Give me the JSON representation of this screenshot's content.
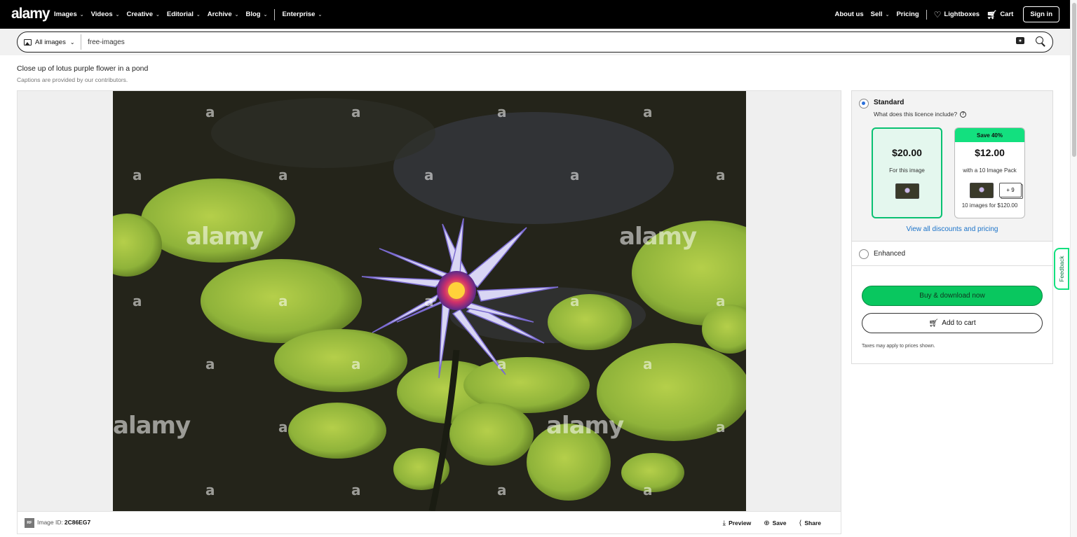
{
  "nav": {
    "logo": "alamy",
    "links": [
      {
        "label": "Images"
      },
      {
        "label": "Videos"
      },
      {
        "label": "Creative"
      },
      {
        "label": "Editorial"
      },
      {
        "label": "Archive"
      },
      {
        "label": "Blog"
      },
      {
        "label": "Enterprise"
      }
    ],
    "about": "About us",
    "sell": "Sell",
    "pricing": "Pricing",
    "lightboxes": "Lightboxes",
    "cart": "Cart",
    "signin": "Sign in"
  },
  "search": {
    "scope": "All images",
    "query": "free-images"
  },
  "caption": {
    "title": "Close up of lotus purple flower in a pond",
    "note": "Captions are provided by our contributors."
  },
  "image": {
    "watermark": "alamy",
    "watermark_small": "a",
    "rf_badge": "RF",
    "id_label": "Image ID:",
    "id_value": "2C86EG7",
    "actions": {
      "preview": "Preview",
      "save": "Save",
      "share": "Share"
    }
  },
  "licence": {
    "standard": "Standard",
    "question": "What does this licence include?",
    "single": {
      "price": "$20.00",
      "sub": "For this image"
    },
    "pack": {
      "badge": "Save 40%",
      "price": "$12.00",
      "sub": "with a 10 Image Pack",
      "more": "+ 9",
      "foot": "10 images for $120.00"
    },
    "view_all": "View all discounts and pricing",
    "enhanced": "Enhanced",
    "buy": "Buy & download now",
    "add_cart": "Add to cart",
    "taxes": "Taxes may apply to prices shown."
  },
  "feedback": "Feedback",
  "colors": {
    "accent_green": "#09c75f",
    "badge_green": "#13e07f",
    "link_blue": "#1b73c9"
  },
  "icons": [
    "image-icon",
    "chevron-down-icon",
    "camera-icon",
    "search-icon",
    "heart-icon",
    "cart-icon",
    "download-icon",
    "plus-circle-icon",
    "share-icon",
    "question-icon"
  ]
}
